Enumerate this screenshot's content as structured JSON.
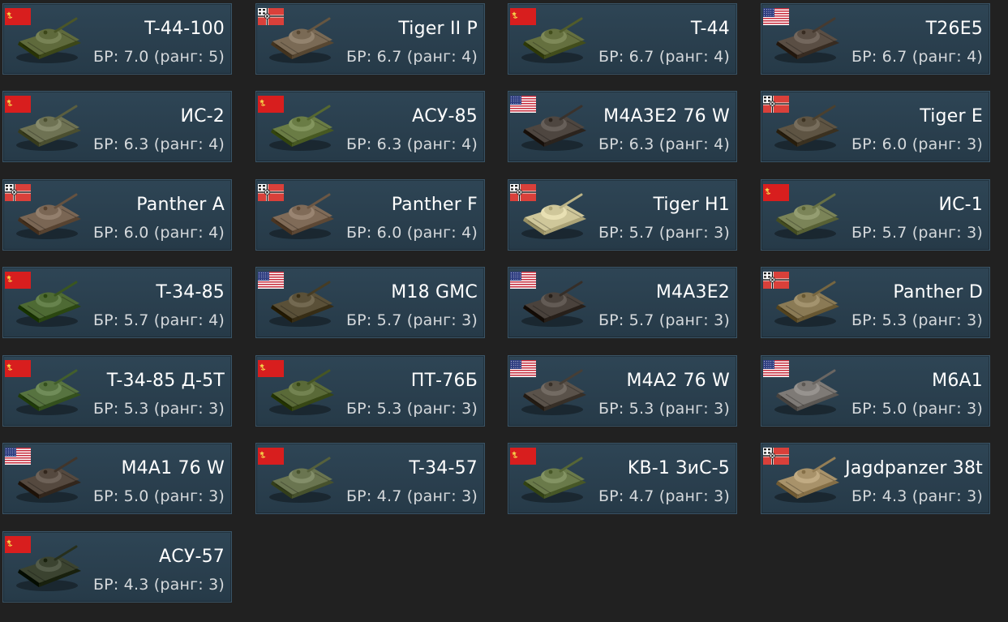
{
  "vehicles": [
    {
      "name": "T-44-100",
      "br": "БР: 7.0 (ранг: 5)",
      "nation": "ussr",
      "flag_icon": "ussr-flag-icon",
      "tank_color": "#5f6a3c"
    },
    {
      "name": "Tiger II P",
      "br": "БР: 6.7 (ранг: 4)",
      "nation": "germany",
      "flag_icon": "germany-flag-icon",
      "tank_color": "#7a6a55"
    },
    {
      "name": "T-44",
      "br": "БР: 6.7 (ранг: 4)",
      "nation": "ussr",
      "flag_icon": "ussr-flag-icon",
      "tank_color": "#65703f"
    },
    {
      "name": "T26E5",
      "br": "БР: 6.7 (ранг: 4)",
      "nation": "usa",
      "flag_icon": "usa-flag-icon",
      "tank_color": "#5a4e44"
    },
    {
      "name": "ИС-2",
      "br": "БР: 6.3 (ранг: 4)",
      "nation": "ussr",
      "flag_icon": "ussr-flag-icon",
      "tank_color": "#6e7253"
    },
    {
      "name": "АСУ-85",
      "br": "БР: 6.3 (ранг: 4)",
      "nation": "ussr",
      "flag_icon": "ussr-flag-icon",
      "tank_color": "#6a7c45"
    },
    {
      "name": "M4A3E2 76 W",
      "br": "БР: 6.3 (ранг: 4)",
      "nation": "usa",
      "flag_icon": "usa-flag-icon",
      "tank_color": "#4e4640"
    },
    {
      "name": "Tiger E",
      "br": "БР: 6.0 (ранг: 3)",
      "nation": "germany",
      "flag_icon": "germany-flag-icon",
      "tank_color": "#5e5443"
    },
    {
      "name": "Panther A",
      "br": "БР: 6.0 (ранг: 4)",
      "nation": "germany",
      "flag_icon": "germany-flag-icon",
      "tank_color": "#7a6654"
    },
    {
      "name": "Panther F",
      "br": "БР: 6.0 (ранг: 4)",
      "nation": "germany",
      "flag_icon": "germany-flag-icon",
      "tank_color": "#806b58"
    },
    {
      "name": "Tiger H1",
      "br": "БР: 5.7 (ранг: 3)",
      "nation": "germany",
      "flag_icon": "germany-flag-icon",
      "tank_color": "#cfc79a"
    },
    {
      "name": "ИС-1",
      "br": "БР: 5.7 (ранг: 3)",
      "nation": "ussr",
      "flag_icon": "ussr-flag-icon",
      "tank_color": "#7b8458"
    },
    {
      "name": "T-34-85",
      "br": "БР: 5.7 (ранг: 4)",
      "nation": "ussr",
      "flag_icon": "ussr-flag-icon",
      "tank_color": "#4e6a34"
    },
    {
      "name": "M18 GMC",
      "br": "БР: 5.7 (ранг: 3)",
      "nation": "usa",
      "flag_icon": "usa-flag-icon",
      "tank_color": "#5a5038"
    },
    {
      "name": "M4A3E2",
      "br": "БР: 5.7 (ранг: 3)",
      "nation": "usa",
      "flag_icon": "usa-flag-icon",
      "tank_color": "#4a423c"
    },
    {
      "name": "Panther D",
      "br": "БР: 5.3 (ранг: 3)",
      "nation": "germany",
      "flag_icon": "germany-flag-icon",
      "tank_color": "#8a7a55"
    },
    {
      "name": "T-34-85 Д-5T",
      "br": "БР: 5.3 (ранг: 3)",
      "nation": "ussr",
      "flag_icon": "ussr-flag-icon",
      "tank_color": "#577340"
    },
    {
      "name": "ПТ-76Б",
      "br": "БР: 5.3 (ранг: 3)",
      "nation": "ussr",
      "flag_icon": "ussr-flag-icon",
      "tank_color": "#5a6a38"
    },
    {
      "name": "M4A2 76 W",
      "br": "БР: 5.3 (ранг: 3)",
      "nation": "usa",
      "flag_icon": "usa-flag-icon",
      "tank_color": "#5a524a"
    },
    {
      "name": "M6A1",
      "br": "БР: 5.0 (ранг: 3)",
      "nation": "usa",
      "flag_icon": "usa-flag-icon",
      "tank_color": "#7e7a76"
    },
    {
      "name": "M4A1 76 W",
      "br": "БР: 5.0 (ранг: 3)",
      "nation": "usa",
      "flag_icon": "usa-flag-icon",
      "tank_color": "#55493f"
    },
    {
      "name": "T-34-57",
      "br": "БР: 4.7 (ранг: 3)",
      "nation": "ussr",
      "flag_icon": "ussr-flag-icon",
      "tank_color": "#6a7550"
    },
    {
      "name": "KB-1 ЗиС-5",
      "br": "БР: 4.7 (ранг: 3)",
      "nation": "ussr",
      "flag_icon": "ussr-flag-icon",
      "tank_color": "#6a7a4a"
    },
    {
      "name": "Jagdpanzer 38t",
      "br": "БР: 4.3 (ранг: 3)",
      "nation": "germany",
      "flag_icon": "germany-flag-icon",
      "tank_color": "#a8926a"
    },
    {
      "name": "АСУ-57",
      "br": "БР: 4.3 (ранг: 3)",
      "nation": "ussr",
      "flag_icon": "ussr-flag-icon",
      "tank_color": "#3b4330"
    }
  ]
}
